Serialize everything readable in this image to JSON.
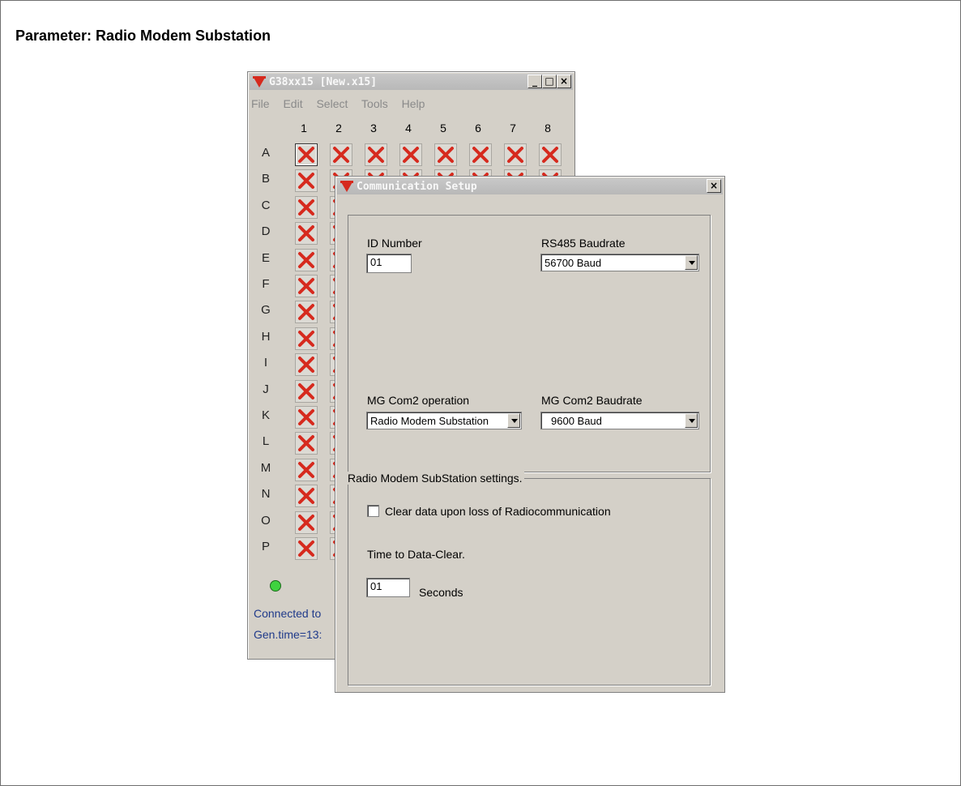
{
  "page": {
    "title": "Parameter: Radio Modem Substation"
  },
  "main_window": {
    "title": "G38xx15 [New.x15]",
    "controls": {
      "minimize": "_",
      "maximize": "□",
      "close": "×"
    },
    "menu": [
      "File",
      "Edit",
      "Select",
      "Tools",
      "Help"
    ],
    "columns": [
      "1",
      "2",
      "3",
      "4",
      "5",
      "6",
      "7",
      "8"
    ],
    "rows": [
      "A",
      "B",
      "C",
      "D",
      "E",
      "F",
      "G",
      "H",
      "I",
      "J",
      "K",
      "L",
      "M",
      "N",
      "O",
      "P"
    ],
    "cell_icon": "red-x-icon",
    "status_led_color": "#3fd33f",
    "status_line1": "Connected to",
    "status_line2": "Gen.time=13:"
  },
  "dialog": {
    "title": "Communication Setup",
    "close": "×",
    "id_number": {
      "label": "ID Number",
      "value": "01"
    },
    "rs485_baudrate": {
      "label": "RS485 Baudrate",
      "value": "56700 Baud"
    },
    "mg_com2_operation": {
      "label": "MG Com2 operation",
      "value": "Radio Modem Substation"
    },
    "mg_com2_baudrate": {
      "label": "MG Com2 Baudrate",
      "value": "9600 Baud"
    },
    "group_title": "Radio Modem SubStation settings.",
    "clear_data_checkbox": {
      "label": "Clear data upon loss of Radiocommunication",
      "checked": false
    },
    "time_to_clear": {
      "label": "Time to Data-Clear.",
      "value": "01",
      "unit": "Seconds"
    }
  },
  "colors": {
    "accent_red": "#d62a1e",
    "titlebar_gray": "#bdbdbd",
    "window_face": "#d4d0c8",
    "status_blue": "#1f3a8a"
  }
}
